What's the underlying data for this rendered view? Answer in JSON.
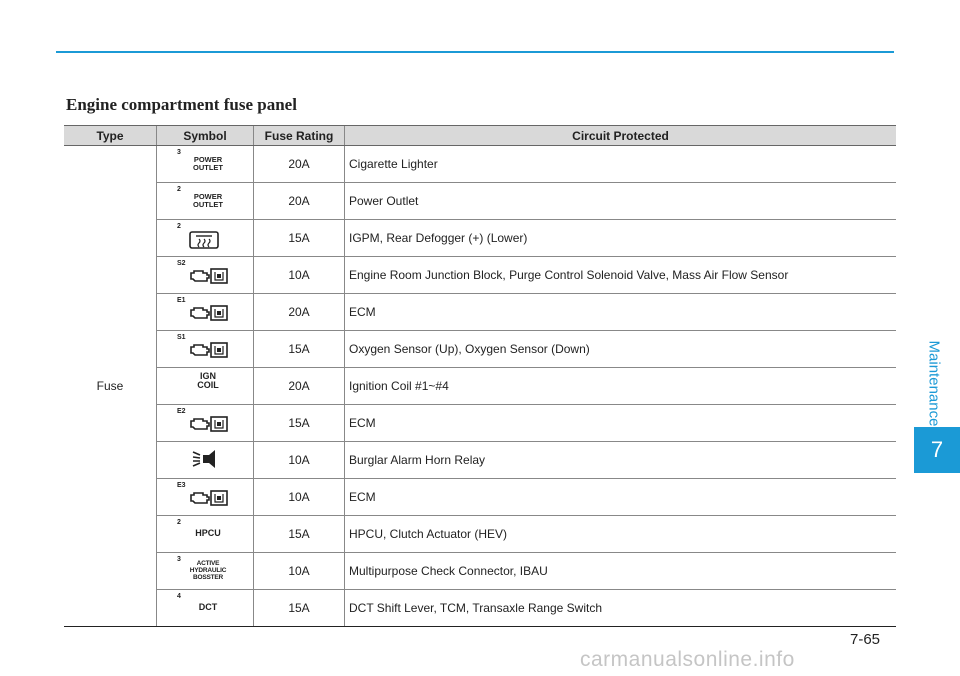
{
  "section_title": "Engine compartment fuse panel",
  "side_label": "Maintenance",
  "chapter_number": "7",
  "page_number": "7-65",
  "watermark": "carmanualsonline.info",
  "table": {
    "headers": [
      "Type",
      "Symbol",
      "Fuse Rating",
      "Circuit Protected"
    ],
    "type_label": "Fuse",
    "rows": [
      {
        "symbol": {
          "kind": "text",
          "sup": "3",
          "text": [
            "POWER",
            "OUTLET"
          ]
        },
        "rating": "20A",
        "circuit": "Cigarette Lighter"
      },
      {
        "symbol": {
          "kind": "text",
          "sup": "2",
          "text": [
            "POWER",
            "OUTLET"
          ]
        },
        "rating": "20A",
        "circuit": "Power Outlet"
      },
      {
        "symbol": {
          "kind": "icon",
          "sup": "2",
          "icon": "rear-defogger-icon"
        },
        "rating": "15A",
        "circuit": "IGPM, Rear Defogger (+) (Lower)"
      },
      {
        "symbol": {
          "kind": "icon",
          "sup": "S2",
          "icon": "engine-ecu-icon"
        },
        "rating": "10A",
        "circuit": "Engine Room Junction Block, Purge Control Solenoid Valve, Mass Air Flow Sensor"
      },
      {
        "symbol": {
          "kind": "icon",
          "sup": "E1",
          "icon": "engine-ecu-icon"
        },
        "rating": "20A",
        "circuit": "ECM"
      },
      {
        "symbol": {
          "kind": "icon",
          "sup": "S1",
          "icon": "engine-ecu-icon"
        },
        "rating": "15A",
        "circuit": "Oxygen Sensor (Up), Oxygen Sensor (Down)"
      },
      {
        "symbol": {
          "kind": "text",
          "sup": "",
          "text": [
            "IGN",
            "COIL"
          ]
        },
        "rating": "20A",
        "circuit": "Ignition Coil #1~#4"
      },
      {
        "symbol": {
          "kind": "icon",
          "sup": "E2",
          "icon": "engine-ecu-icon"
        },
        "rating": "15A",
        "circuit": "ECM"
      },
      {
        "symbol": {
          "kind": "icon",
          "sup": "",
          "icon": "horn-icon"
        },
        "rating": "10A",
        "circuit": "Burglar Alarm Horn Relay"
      },
      {
        "symbol": {
          "kind": "icon",
          "sup": "E3",
          "icon": "engine-ecu-icon"
        },
        "rating": "10A",
        "circuit": "ECM"
      },
      {
        "symbol": {
          "kind": "text",
          "sup": "2",
          "text": [
            "HPCU"
          ]
        },
        "rating": "15A",
        "circuit": "HPCU, Clutch Actuator (HEV)"
      },
      {
        "symbol": {
          "kind": "text",
          "sup": "3",
          "text": [
            "ACTIVE",
            "HYDRAULIC",
            "BOSSTER"
          ]
        },
        "rating": "10A",
        "circuit": "Multipurpose Check Connector, IBAU"
      },
      {
        "symbol": {
          "kind": "text",
          "sup": "4",
          "text": [
            "DCT"
          ]
        },
        "rating": "15A",
        "circuit": "DCT Shift Lever, TCM, Transaxle Range Switch"
      }
    ]
  },
  "colors": {
    "accent": "#1b9ad6",
    "header_bg": "#d9d9d9"
  }
}
